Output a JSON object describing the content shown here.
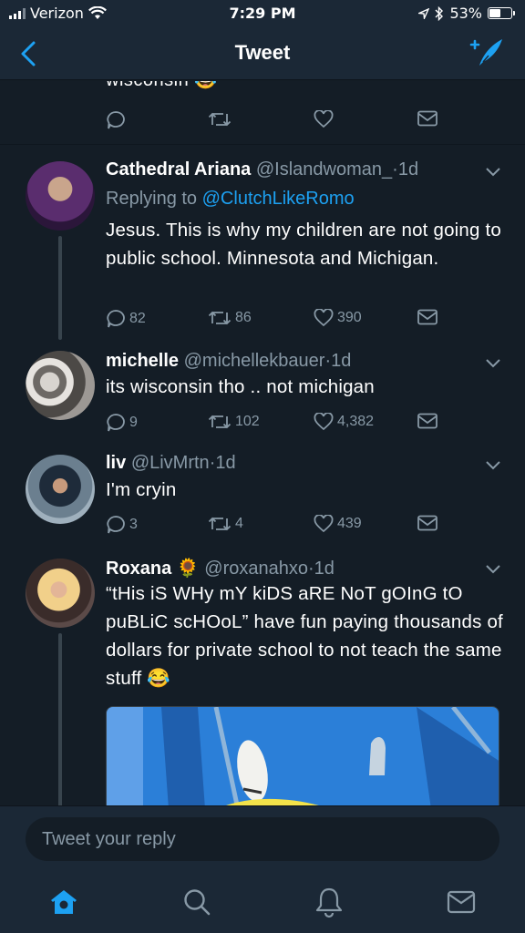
{
  "status_bar": {
    "carrier": "Verizon",
    "time": "7:29 PM",
    "battery": "53%",
    "battery_level": 0.53
  },
  "nav": {
    "title": "Tweet"
  },
  "partial_tweet": {
    "text_tail": "wisconsin",
    "emoji": "😂"
  },
  "tweets": [
    {
      "name": "Cathedral Ariana",
      "handle": "@Islandwoman_",
      "time": "1d",
      "replying_label": "Replying to",
      "replying_to": "@ClutchLikeRomo",
      "text": "Jesus. This is why my children are not going to public school. Minnesota and Michigan.",
      "replies": "82",
      "retweets": "86",
      "likes": "390"
    },
    {
      "name": "michelle",
      "handle": "@michellekbauer",
      "time": "1d",
      "text": "its wisconsin tho .. not michigan",
      "replies": "9",
      "retweets": "102",
      "likes": "4,382"
    },
    {
      "name": "liv",
      "handle": "@LivMrtn",
      "time": "1d",
      "text": "I'm cryin",
      "replies": "3",
      "retweets": "4",
      "likes": "439"
    },
    {
      "name": "Roxana",
      "name_emoji": "🌻",
      "handle": "@roxanahxo",
      "time": "1d",
      "text": "“tHis iS WHy mY kiDS aRE NoT gOInG tO puBLiC scHOoL” have fun paying thousands of dollars for private school to not teach the same stuff",
      "text_emoji": "😂"
    }
  ],
  "reply_box": {
    "placeholder": "Tweet your reply"
  },
  "tab_bar": {
    "items": [
      "home-icon",
      "search-icon",
      "notifications-icon",
      "messages-icon"
    ],
    "active": "home-icon"
  },
  "colors": {
    "background": "#141d26",
    "bar": "#1b2836",
    "accent": "#1da1f2",
    "muted": "#8899a6"
  }
}
